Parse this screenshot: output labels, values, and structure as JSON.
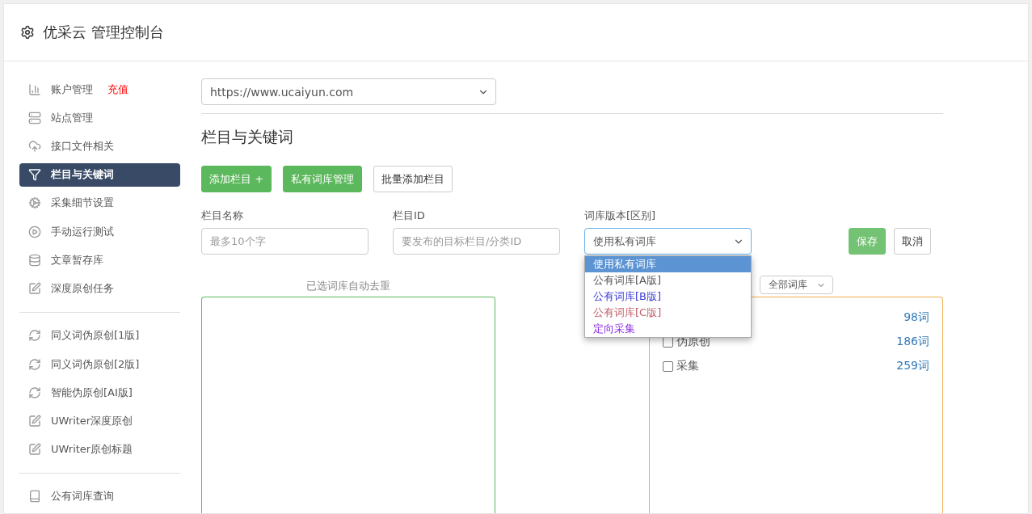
{
  "header": {
    "title": "优采云 管理控制台"
  },
  "sidebar": {
    "groups": [
      {
        "items": [
          {
            "label": "账户管理",
            "badge": "充值",
            "selected": false
          },
          {
            "label": "站点管理",
            "selected": false
          },
          {
            "label": "接口文件相关",
            "selected": false
          },
          {
            "label": "栏目与关键词",
            "selected": true
          },
          {
            "label": "采集细节设置",
            "selected": false
          },
          {
            "label": "手动运行测试",
            "selected": false
          },
          {
            "label": "文章暂存库",
            "selected": false
          },
          {
            "label": "深度原创任务",
            "selected": false
          }
        ]
      },
      {
        "items": [
          {
            "label": "同义词伪原创[1版]",
            "selected": false
          },
          {
            "label": "同义词伪原创[2版]",
            "selected": false
          },
          {
            "label": "智能伪原创[AI版]",
            "selected": false
          },
          {
            "label": "UWriter深度原创",
            "selected": false
          },
          {
            "label": "UWriter原创标题",
            "selected": false
          }
        ]
      },
      {
        "items": [
          {
            "label": "公有词库查询",
            "selected": false
          }
        ]
      }
    ]
  },
  "site_select": {
    "value": "https://www.ucaiyun.com"
  },
  "section_title": "栏目与关键词",
  "actions": [
    {
      "label": "添加栏目 +",
      "kind": "primary"
    },
    {
      "label": "私有词库管理",
      "kind": "primary"
    },
    {
      "label": "批量添加栏目",
      "kind": "default"
    }
  ],
  "form": {
    "name_field": {
      "label": "栏目名称",
      "placeholder": "最多10个字"
    },
    "id_field": {
      "label": "栏目ID",
      "placeholder": "要发布的目标栏目/分类ID"
    },
    "library_select": {
      "label": "词库版本[区别]",
      "value": "使用私有词库",
      "expanded": true,
      "options": [
        {
          "label": "使用私有词库",
          "selected": true
        },
        {
          "label": "公有词库[A版]",
          "selected": false,
          "color": "#555555"
        },
        {
          "label": "公有词库[B版]",
          "selected": false,
          "color": "#3b3bd6"
        },
        {
          "label": "公有词库[C版]",
          "selected": false,
          "color": "#c0606a"
        },
        {
          "label": "定向采集",
          "selected": false,
          "color": "#8a2be2"
        }
      ]
    },
    "save_button": "保存",
    "cancel_button": "取消"
  },
  "selected_hint": "已选词库自动去重",
  "library_filter": {
    "value": "全部词库"
  },
  "libraries": [
    {
      "count": "98词"
    },
    {
      "label": "伪原创",
      "count": "186词",
      "checked": false
    },
    {
      "label": "采集",
      "count": "259词",
      "checked": false
    }
  ]
}
